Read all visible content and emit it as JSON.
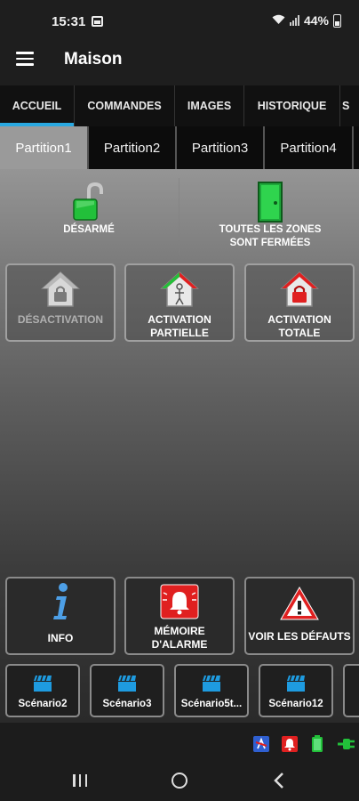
{
  "status_bar": {
    "time": "15:31",
    "battery": "44%"
  },
  "app": {
    "title": "Maison"
  },
  "tabs": [
    {
      "label": "ACCUEIL",
      "active": true
    },
    {
      "label": "COMMANDES",
      "active": false
    },
    {
      "label": "IMAGES",
      "active": false
    },
    {
      "label": "HISTORIQUE",
      "active": false
    },
    {
      "label": "S",
      "active": false
    }
  ],
  "partitions": [
    {
      "label": "Partition1",
      "active": true
    },
    {
      "label": "Partition2",
      "active": false
    },
    {
      "label": "Partition3",
      "active": false
    },
    {
      "label": "Partition4",
      "active": false
    }
  ],
  "status": {
    "armed_label": "DÉSARMÉ",
    "zones_label_1": "TOUTES LES ZONES",
    "zones_label_2": "SONT FERMÉES"
  },
  "actions": {
    "disable": "DÉSACTIVATION",
    "partial_1": "ACTIVATION",
    "partial_2": "PARTIELLE",
    "total_1": "ACTIVATION",
    "total_2": "TOTALE"
  },
  "info_buttons": {
    "info": "INFO",
    "memory_1": "MÉMOIRE",
    "memory_2": "D'ALARME",
    "defaults": "VOIR LES DÉFAUTS"
  },
  "scenarios": [
    {
      "label": "Scénario2"
    },
    {
      "label": "Scénario3"
    },
    {
      "label": "Scénario5t..."
    },
    {
      "label": "Scénario12"
    }
  ],
  "colors": {
    "accent": "#29a8e0",
    "green": "#22c03a",
    "red": "#e02020",
    "clap_blue": "#1e9be0"
  },
  "icons": {
    "armed_status": "unlocked-padlock-icon",
    "zones_status": "green-door-icon",
    "disable": "house-lock-icon",
    "partial": "house-person-icon",
    "total": "house-lock-red-icon",
    "info": "info-icon",
    "memory": "alarm-bell-icon",
    "defaults": "warning-icon",
    "scenario": "clapperboard-icon"
  }
}
